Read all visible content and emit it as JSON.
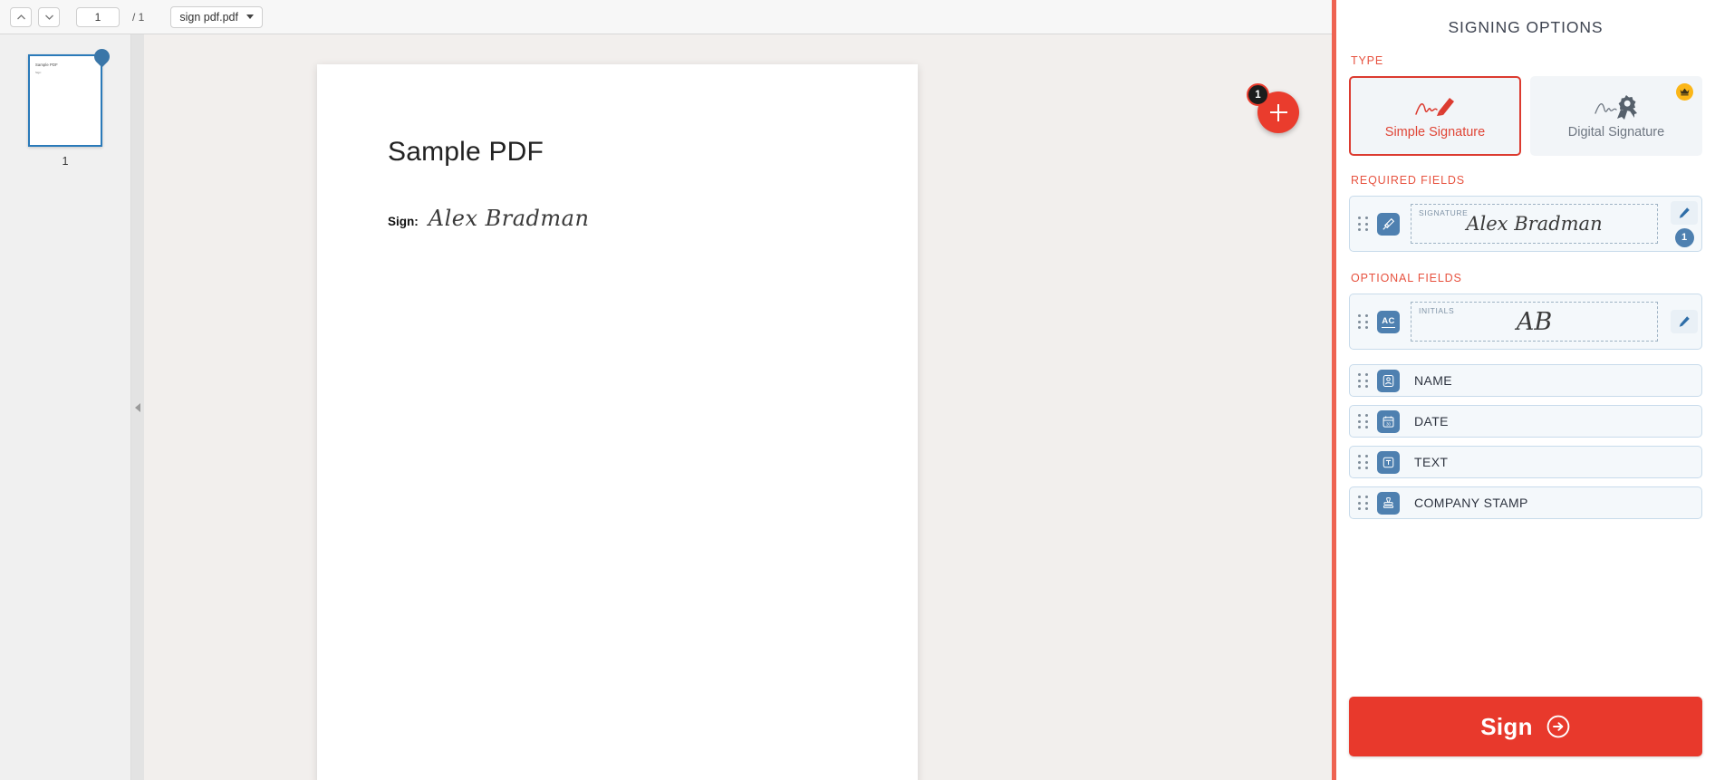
{
  "toolbar": {
    "prev_page_icon": "chevron-up-icon",
    "next_page_icon": "chevron-down-icon",
    "current_page": "1",
    "page_total": "/ 1",
    "file_name": "sign pdf.pdf"
  },
  "thumbnails": {
    "pages": [
      {
        "number": "1",
        "title": "Sample PDF",
        "subtitle": "Sign:"
      }
    ]
  },
  "document": {
    "title": "Sample PDF",
    "sign_label": "Sign:",
    "signature_value": "Alex Bradman"
  },
  "floating_button": {
    "icon": "plus-icon",
    "badge": "1"
  },
  "panel": {
    "title": "SIGNING OPTIONS",
    "type_section_label": "TYPE",
    "types": [
      {
        "label": "Simple Signature",
        "icon": "signature-pen-icon",
        "selected": true,
        "premium": false
      },
      {
        "label": "Digital Signature",
        "icon": "certificate-seal-icon",
        "selected": false,
        "premium": true,
        "premium_icon": "crown-icon"
      }
    ],
    "required_section_label": "REQUIRED FIELDS",
    "required_fields": [
      {
        "label": "SIGNATURE",
        "value": "Alex Bradman",
        "icon": "pen-nib-icon",
        "edit_icon": "pencil-icon",
        "count": "1"
      }
    ],
    "optional_section_label": "OPTIONAL FIELDS",
    "optional_fields": [
      {
        "label": "INITIALS",
        "value": "AB",
        "icon": "initials-ac-icon",
        "icon_text": "AC",
        "edit_icon": "pencil-icon"
      },
      {
        "label": "NAME",
        "icon": "person-icon"
      },
      {
        "label": "DATE",
        "icon": "calendar-icon"
      },
      {
        "label": "TEXT",
        "icon": "text-box-icon"
      },
      {
        "label": "COMPANY STAMP",
        "icon": "stamp-icon"
      }
    ],
    "sign_button": {
      "label": "Sign",
      "icon": "arrow-right-circle-icon"
    }
  },
  "colors": {
    "accent_red": "#e8392c",
    "divider_red": "#ee6352",
    "field_blue": "#4e80b0",
    "premium_gold": "#fbb618"
  }
}
